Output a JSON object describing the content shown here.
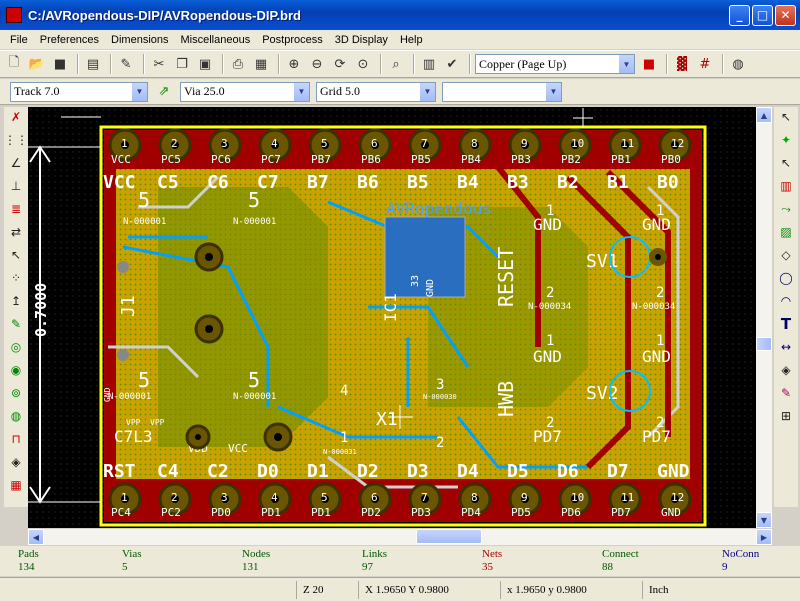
{
  "window": {
    "title": "C:/AVRopendous-DIP/AVRopendous-DIP.brd"
  },
  "menu": [
    "File",
    "Preferences",
    "Dimensions",
    "Miscellaneous",
    "Postprocess",
    "3D Display",
    "Help"
  ],
  "toolbar": {
    "layer_select": "Copper (Page Up)"
  },
  "toolbar2": {
    "track": "Track 7.0",
    "via": "Via 25.0",
    "grid": "Grid 5.0",
    "zoom": ""
  },
  "board": {
    "dimension_label": "0.7000",
    "logo_text": "AVRopendous",
    "top_pins": [
      {
        "num": "1",
        "net": "VCC"
      },
      {
        "num": "2",
        "net": "PC5"
      },
      {
        "num": "3",
        "net": "PC6"
      },
      {
        "num": "4",
        "net": "PC7"
      },
      {
        "num": "5",
        "net": "PB7"
      },
      {
        "num": "6",
        "net": "PB6"
      },
      {
        "num": "7",
        "net": "PB5"
      },
      {
        "num": "8",
        "net": "PB4"
      },
      {
        "num": "9",
        "net": "PB3"
      },
      {
        "num": "10",
        "net": "PB2"
      },
      {
        "num": "11",
        "net": "PB1"
      },
      {
        "num": "12",
        "net": "PB0"
      }
    ],
    "top_silk": [
      "VCC",
      "C5",
      "C6",
      "C7",
      "B7",
      "B6",
      "B5",
      "B4",
      "B3",
      "B2",
      "B1",
      "B0"
    ],
    "bottom_pins": [
      {
        "num": "1",
        "net": "PC4"
      },
      {
        "num": "2",
        "net": "PC2"
      },
      {
        "num": "3",
        "net": "PD0"
      },
      {
        "num": "4",
        "net": "PD1"
      },
      {
        "num": "5",
        "net": "PD1"
      },
      {
        "num": "6",
        "net": "PD2"
      },
      {
        "num": "7",
        "net": "PD3"
      },
      {
        "num": "8",
        "net": "PD4"
      },
      {
        "num": "9",
        "net": "PD5"
      },
      {
        "num": "10",
        "net": "PD6"
      },
      {
        "num": "11",
        "net": "PD7"
      },
      {
        "num": "12",
        "net": "GND"
      }
    ],
    "bottom_silk": [
      "RST",
      "C4",
      "C2",
      "D0",
      "D1",
      "D2",
      "D3",
      "D4",
      "D5",
      "D6",
      "D7",
      "GND"
    ],
    "labels": {
      "c5": "5",
      "net1": "N-000001",
      "c5b": "5",
      "net1b": "N-000001",
      "c5c": "5",
      "net1c": "N-000001",
      "c5d": "5",
      "net1d": "N-000001",
      "gnd1": "1",
      "gnd1t": "GND",
      "gnd2": "1",
      "gnd2t": "GND",
      "sv1": "SV1",
      "sv2": "SV2",
      "n34a": "N-000034",
      "n34b": "N-000034",
      "two_a": "2",
      "two_b": "2",
      "gnd3": "1",
      "gnd3t": "GND",
      "gnd4": "1",
      "gnd4t": "GND",
      "pd7a": "2",
      "pd7at": "PD7",
      "pd7b": "2",
      "pd7bt": "PD7",
      "reset": "RESET",
      "hwb": "HWB",
      "ic1": "IC1",
      "gnd33": "33",
      "gnd33t": "GND",
      "j1": "J1",
      "c7l3": "C7L3",
      "vdd": "VDD",
      "vcc": "VCC",
      "x1": "X1",
      "four": "4",
      "three": "3",
      "two_c": "2",
      "one_c": "1",
      "net31": "N-000031",
      "net30": "N-000030",
      "vpp": "VPP",
      "vpp2": "VPP",
      "gnd_v": "GND"
    }
  },
  "status": [
    {
      "label": "Pads",
      "value": "134",
      "color": "#005500"
    },
    {
      "label": "Vias",
      "value": "5",
      "color": "#005500"
    },
    {
      "label": "Nodes",
      "value": "131",
      "color": "#005500"
    },
    {
      "label": "Links",
      "value": "97",
      "color": "#005500"
    },
    {
      "label": "Nets",
      "value": "35",
      "color": "#aa0000"
    },
    {
      "label": "Connect",
      "value": "88",
      "color": "#005500"
    },
    {
      "label": "NoConn",
      "value": "9",
      "color": "#000088"
    }
  ],
  "statusbar": {
    "zoom": "Z 20",
    "abs": "X 1.9650  Y 0.9800",
    "rel": "x 1.9650  y 0.9800",
    "units": "Inch"
  }
}
